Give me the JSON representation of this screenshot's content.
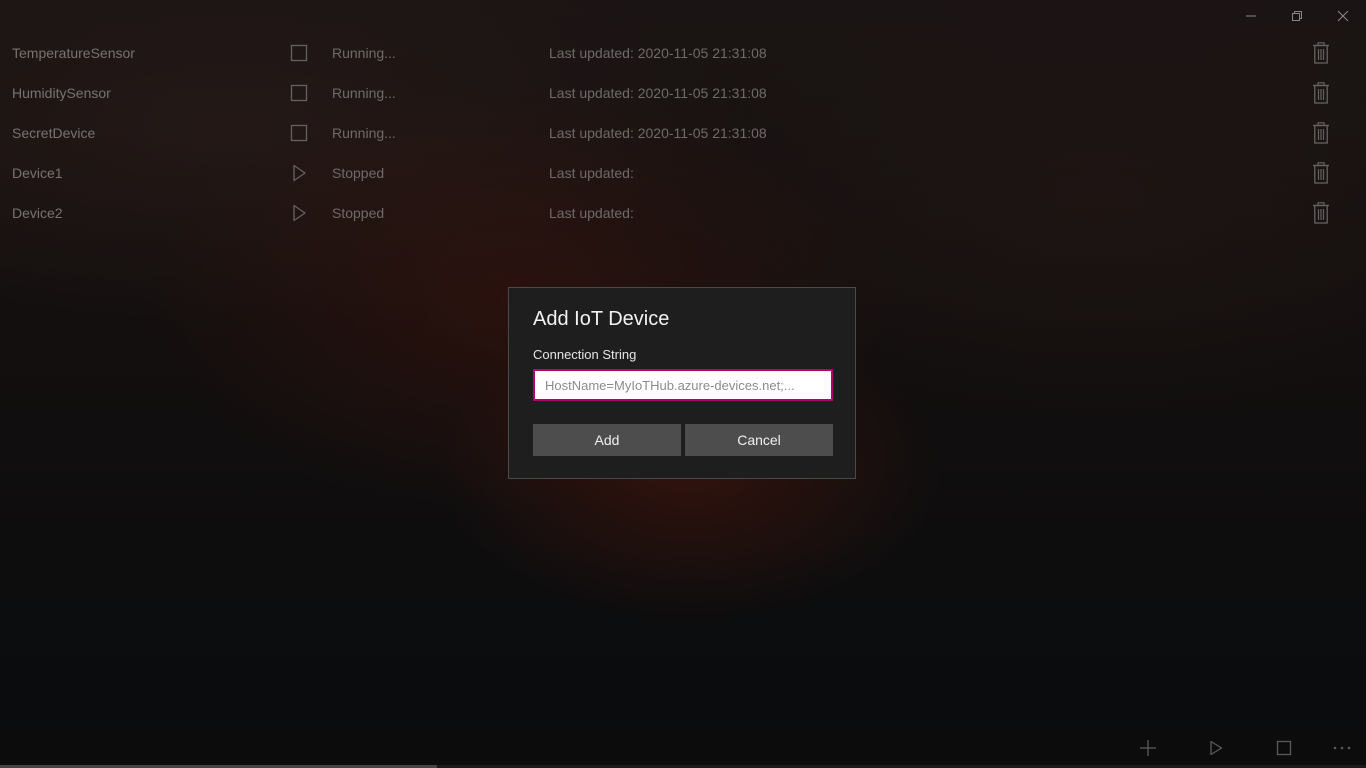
{
  "window": {
    "controls": [
      "minimize-icon",
      "restore-icon",
      "close-icon"
    ]
  },
  "devices": [
    {
      "name": "TemperatureSensor",
      "action_icon": "stop-icon",
      "status": "Running...",
      "last_updated": "Last updated: 2020-11-05 21:31:08"
    },
    {
      "name": "HumiditySensor",
      "action_icon": "stop-icon",
      "status": "Running...",
      "last_updated": "Last updated: 2020-11-05 21:31:08"
    },
    {
      "name": "SecretDevice",
      "action_icon": "stop-icon",
      "status": "Running...",
      "last_updated": "Last updated: 2020-11-05 21:31:08"
    },
    {
      "name": "Device1",
      "action_icon": "play-icon",
      "status": "Stopped",
      "last_updated": "Last updated:"
    },
    {
      "name": "Device2",
      "action_icon": "play-icon",
      "status": "Stopped",
      "last_updated": "Last updated:"
    }
  ],
  "dialog": {
    "title": "Add IoT Device",
    "field_label": "Connection String",
    "input_value": "",
    "input_placeholder": "HostName=MyIoTHub.azure-devices.net;...",
    "add_label": "Add",
    "cancel_label": "Cancel",
    "input_border_color": "#b3006b"
  },
  "command_bar": {
    "icons": [
      "add-icon",
      "play-icon",
      "stop-icon",
      "more-icon"
    ]
  },
  "progress": {
    "fraction": 0.32
  }
}
